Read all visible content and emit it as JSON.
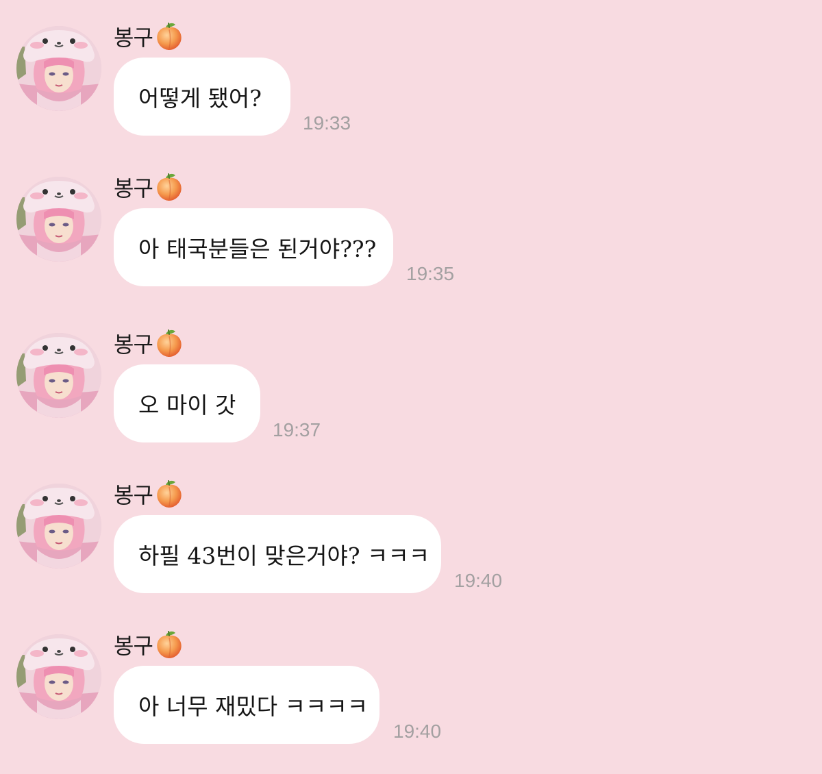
{
  "chat": {
    "messages": [
      {
        "sender": "봉구",
        "sender_icon": "peach-icon",
        "text": "어떻게 됐어?",
        "time": "19:33"
      },
      {
        "sender": "봉구",
        "sender_icon": "peach-icon",
        "text": "아 태국분들은 된거야???",
        "time": "19:35"
      },
      {
        "sender": "봉구",
        "sender_icon": "peach-icon",
        "text": "오 마이 갓",
        "time": "19:37"
      },
      {
        "sender": "봉구",
        "sender_icon": "peach-icon",
        "text": "하필 43번이 맞은거야? ㅋㅋㅋ",
        "time": "19:40"
      },
      {
        "sender": "봉구",
        "sender_icon": "peach-icon",
        "text": "아 너무 재밌다 ㅋㅋㅋㅋ",
        "time": "19:40"
      }
    ]
  },
  "colors": {
    "background": "#f8dbe1",
    "bubble": "#ffffff",
    "timestamp": "#a3a0a1",
    "avatar_hair": "#f2a7bf",
    "avatar_hat": "#f7e6ec",
    "peach": "#f4a15a"
  }
}
